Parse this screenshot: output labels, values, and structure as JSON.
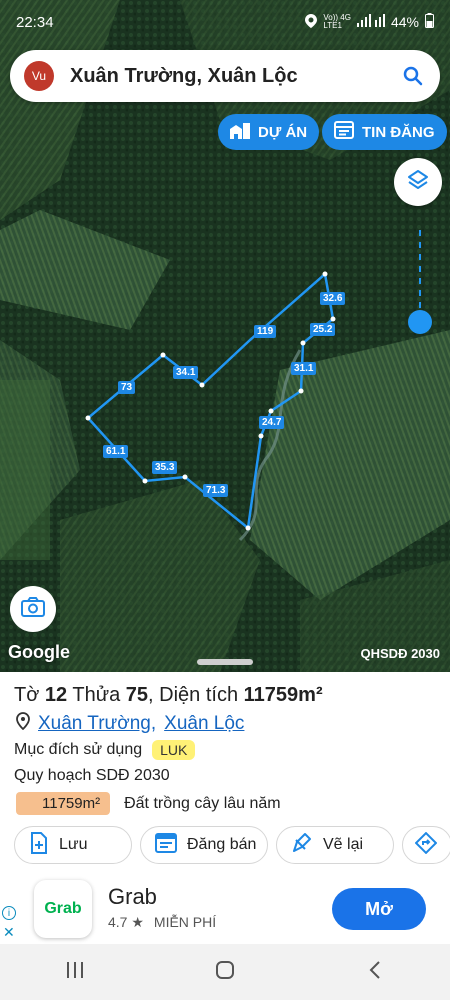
{
  "status_bar": {
    "time": "22:34",
    "network_top": "Vo)) 4G",
    "network_bottom": "LTE1",
    "battery": "44%"
  },
  "search": {
    "avatar_initials": "Vu",
    "query": "Xuân Trường, Xuân Lộc"
  },
  "map": {
    "du_an_label": "DỰ ÁN",
    "tin_dang_label": "TIN ĐĂNG",
    "google_label": "Google",
    "overlay_label": "QHSDĐ 2030",
    "accent_color": "#1e88e5",
    "segment_lengths": [
      "32.6",
      "25.2",
      "31.1",
      "24.7",
      "119",
      "34.1",
      "73",
      "61.1",
      "35.3",
      "71.3"
    ]
  },
  "parcel": {
    "prefix_to": "Tờ",
    "to_number": "12",
    "prefix_thua": "Thửa",
    "thua_number": "75",
    "area_label": "Diện tích",
    "area_value": "11759m²",
    "ward": "Xuân Trường",
    "separator": ",",
    "district": "Xuân Lộc",
    "purpose_label": "Mục đích sử dụng",
    "purpose_code": "LUK",
    "planning_label": "Quy hoạch SDĐ 2030",
    "planning_area": "11759m²",
    "planning_type": "Đất trồng cây lâu năm"
  },
  "actions": {
    "save": "Lưu",
    "sell": "Đăng bán",
    "redraw": "Vẽ lại"
  },
  "ad": {
    "logo_text": "Grab",
    "name": "Grab",
    "rating": "4.7 ★",
    "price": "MIỄN PHÍ",
    "open_label": "Mở"
  }
}
